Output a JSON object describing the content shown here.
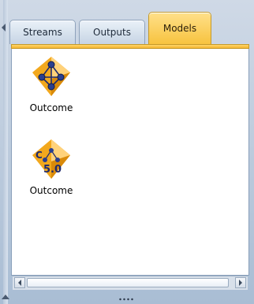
{
  "tabs": [
    {
      "label": "Streams",
      "active": false
    },
    {
      "label": "Outputs",
      "active": false
    },
    {
      "label": "Models",
      "active": true
    }
  ],
  "models": [
    {
      "label": "Outcome",
      "icon": "neural-net-model-icon"
    },
    {
      "label": "Outcome",
      "icon": "c50-model-icon",
      "icon_text": "5.0",
      "icon_prefix": "C"
    }
  ],
  "colors": {
    "active_tab": "#f7c33f",
    "model_gold": "#f2a81d",
    "model_blue": "#2a3f8f",
    "panel_bg": "#ffffff"
  }
}
